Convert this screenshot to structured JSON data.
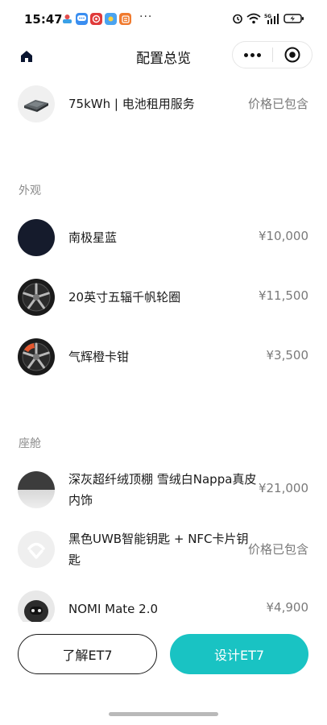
{
  "status_bar": {
    "time": "15:47",
    "more": "···",
    "app_icons": [
      "app-icon-1",
      "message-icon",
      "weibo-icon",
      "sun-icon",
      "tasks-icon"
    ],
    "indicators": [
      "alarm-icon",
      "wifi-icon",
      "5g-signal-icon",
      "battery-charging-icon"
    ]
  },
  "nav": {
    "title": "配置总览",
    "home_icon": "home-icon",
    "more_icon": "more-dots-icon",
    "close_icon": "miniprogram-close-icon"
  },
  "items_top": [
    {
      "name": "75kWh | 电池租用服务",
      "price": "价格已包含",
      "thumb": "battery-pack"
    }
  ],
  "sections": [
    {
      "label": "外观",
      "items": [
        {
          "name": "南极星蓝",
          "price": "¥10,000",
          "thumb": "color-swatch",
          "color": "#151b2c"
        },
        {
          "name": "20英寸五辐千帆轮圈",
          "price": "¥11,500",
          "thumb": "wheel",
          "accent": "#9a9a9a"
        },
        {
          "name": "气辉橙卡钳",
          "price": "¥3,500",
          "thumb": "wheel",
          "accent": "#e4572e"
        }
      ]
    },
    {
      "label": "座舱",
      "items": [
        {
          "name": "深灰超纤绒顶棚 雪绒白Nappa真皮内饰",
          "price": "¥21,000",
          "thumb": "interior-swatch"
        },
        {
          "name": "黑色UWB智能钥匙 + NFC卡片钥匙",
          "price": "价格已包含",
          "thumb": "nio-logo"
        },
        {
          "name": "NOMI Mate 2.0",
          "price": "¥4,900",
          "thumb": "nomi"
        }
      ]
    }
  ],
  "buttons": {
    "learn": "了解ET7",
    "design": "设计ET7"
  },
  "colors": {
    "accent": "#19c3c3",
    "price_text": "#7a7a7a",
    "section_label": "#8c8c8c"
  }
}
